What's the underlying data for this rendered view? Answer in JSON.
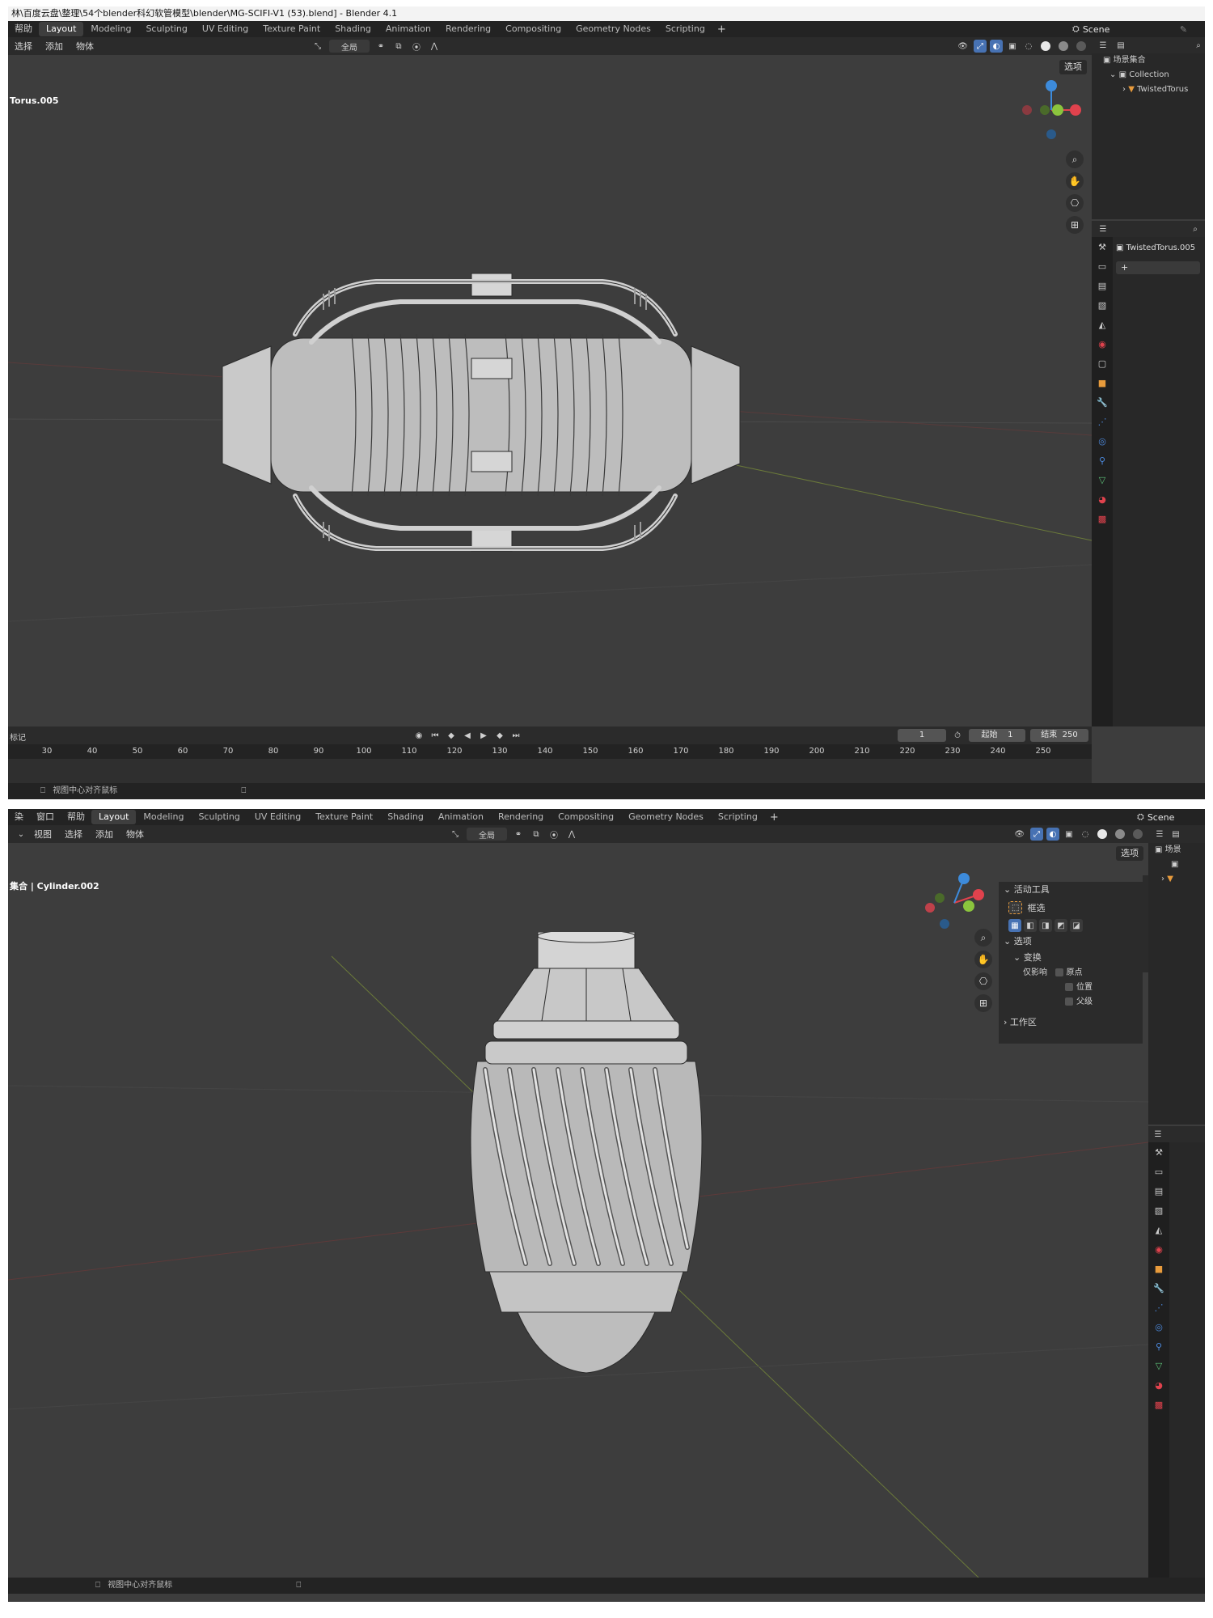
{
  "shot1": {
    "titlebar": "林\\百度云盘\\整理\\54个blender科幻软管模型\\blender\\MG-SCIFI-V1 (53).blend] - Blender 4.1",
    "menu_help": "帮助",
    "tabs": [
      "Layout",
      "Modeling",
      "Sculpting",
      "UV Editing",
      "Texture Paint",
      "Shading",
      "Animation",
      "Rendering",
      "Compositing",
      "Geometry Nodes",
      "Scripting"
    ],
    "tab_plus": "+",
    "scene_label": "Scene",
    "header_menus": [
      "选择",
      "添加",
      "物体"
    ],
    "transform_orientation": "全局",
    "options_label": "选项",
    "object_label": "Torus.005",
    "outliner": {
      "scene_collection": "场景集合",
      "collection": "Collection",
      "object": "TwistedTorus"
    },
    "properties": {
      "object_name": "TwistedTorus.005",
      "add_button": "+"
    },
    "timeline": {
      "marker_label": "标记",
      "current_frame": "1",
      "start_label": "起始",
      "start_value": "1",
      "end_label": "结束",
      "end_value": "250",
      "ticks": [
        "30",
        "40",
        "50",
        "60",
        "70",
        "80",
        "90",
        "100",
        "110",
        "120",
        "130",
        "140",
        "150",
        "160",
        "170",
        "180",
        "190",
        "200",
        "210",
        "220",
        "230",
        "240",
        "250"
      ]
    },
    "status": "视图中心对齐鼠标"
  },
  "shot2": {
    "menus_top": [
      "染",
      "窗口",
      "帮助"
    ],
    "tabs": [
      "Layout",
      "Modeling",
      "Sculpting",
      "UV Editing",
      "Texture Paint",
      "Shading",
      "Animation",
      "Rendering",
      "Compositing",
      "Geometry Nodes",
      "Scripting"
    ],
    "tab_plus": "+",
    "scene_label": "Scene",
    "header_menus": [
      "视图",
      "选择",
      "添加",
      "物体"
    ],
    "transform_orientation": "全局",
    "options_label": "选项",
    "object_label": "集合 | Cylinder.002",
    "tool_panel": {
      "active_tool": "活动工具",
      "box_select": "框选",
      "options": "选项",
      "transform": "变换",
      "affect_only": "仅影响",
      "origins": "原点",
      "locations": "位置",
      "parents": "父级",
      "workspace": "工作区"
    },
    "outliner_partial": "场景",
    "status": "视图中心对齐鼠标"
  },
  "colors": {
    "viewport_bg": "#3d3d3d",
    "header_bg": "#2b2b2b",
    "topbar_bg": "#232323",
    "accent": "#4772b3",
    "axis_x": "#e0424d",
    "axis_y": "#8bc43d",
    "axis_z": "#3d8bdb"
  }
}
